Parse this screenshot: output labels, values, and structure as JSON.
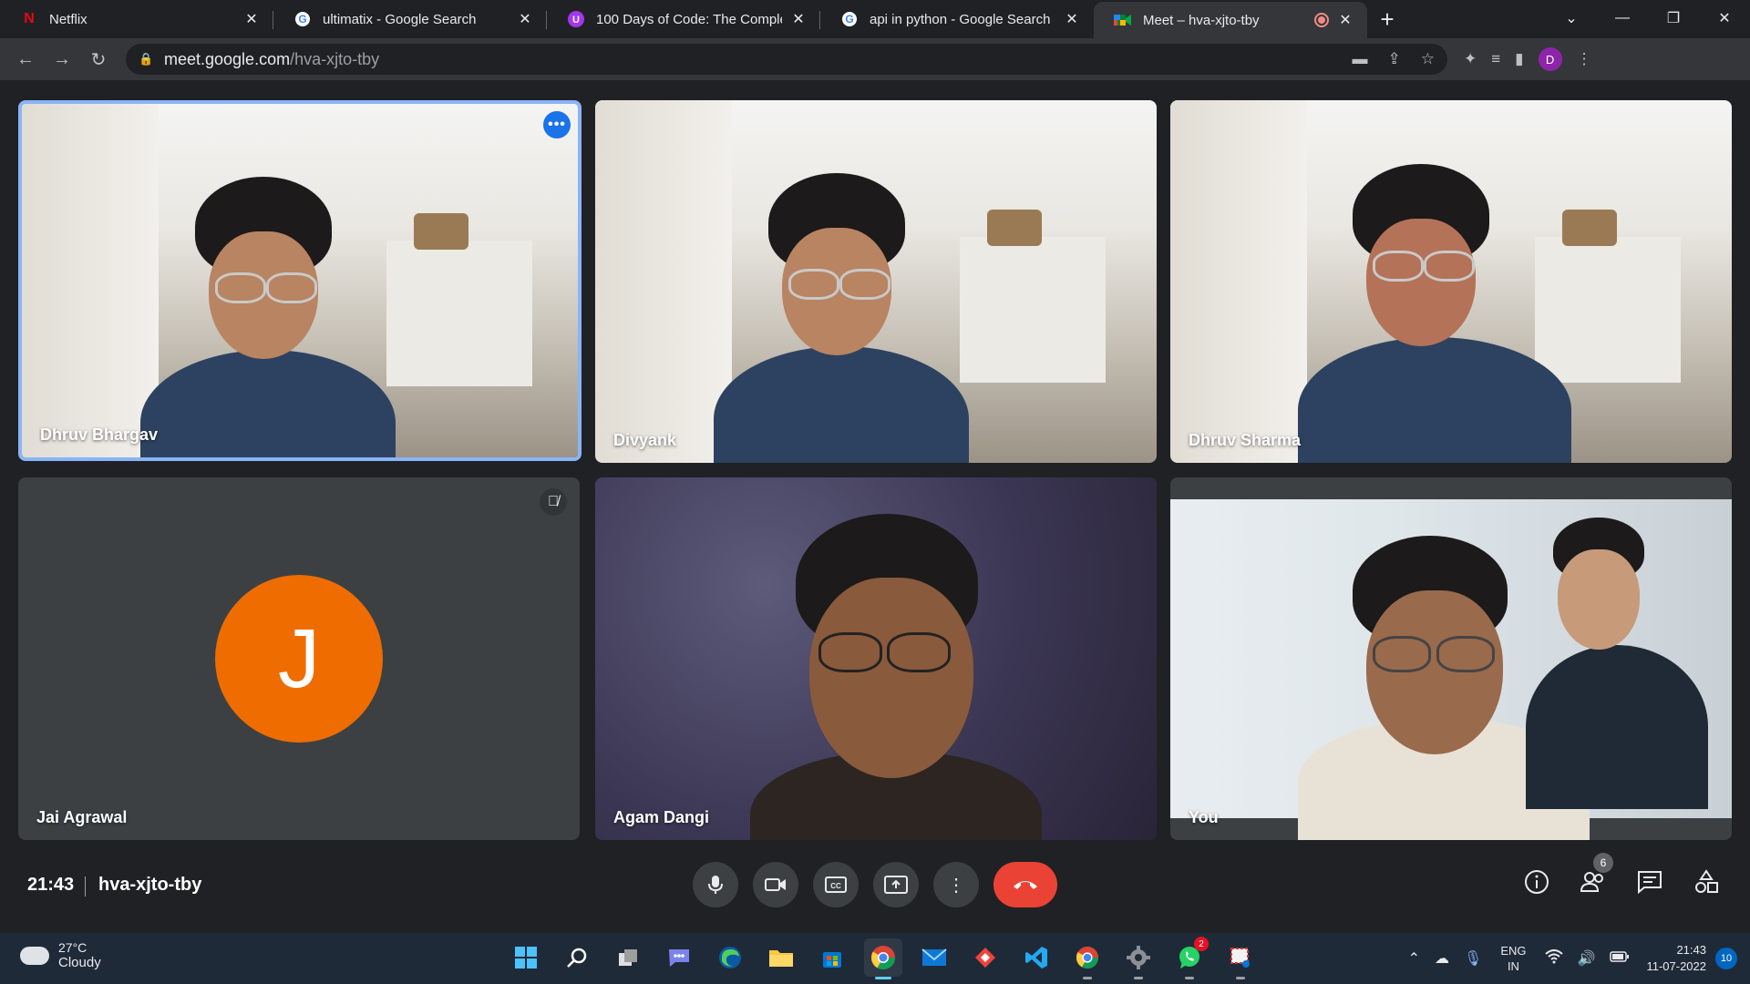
{
  "browser": {
    "tabs": [
      {
        "title": "Netflix",
        "icon": "netflix-icon"
      },
      {
        "title": "ultimatix - Google Search",
        "icon": "google-icon"
      },
      {
        "title": "100 Days of Code: The Complete",
        "icon": "udemy-icon"
      },
      {
        "title": "api in python - Google Search",
        "icon": "google-icon"
      },
      {
        "title": "Meet – hva-xjto-tby",
        "icon": "google-meet-icon",
        "active": true,
        "recording": true
      }
    ],
    "address": {
      "host": "meet.google.com",
      "path": "/hva-xjto-tby"
    },
    "profile_initial": "D"
  },
  "meet": {
    "participants": [
      {
        "name": "Dhruv Bhargav",
        "speaking": true
      },
      {
        "name": "Divyank"
      },
      {
        "name": "Dhruv Sharma"
      },
      {
        "name": "Jai Agrawal",
        "avatar_initial": "J",
        "muted": true,
        "avatar_color": "#ef6c00"
      },
      {
        "name": "Agam Dangi"
      },
      {
        "name": "You"
      }
    ],
    "time": "21:43",
    "code": "hva-xjto-tby",
    "people_count": "6",
    "colors": {
      "end_call": "#ea4335",
      "speaking_border": "#8ab4f8"
    }
  },
  "taskbar": {
    "weather": {
      "temp": "27°C",
      "condition": "Cloudy"
    },
    "whatsapp_badge": "2",
    "language": {
      "line1": "ENG",
      "line2": "IN"
    },
    "clock": {
      "time": "21:43",
      "date": "11-07-2022"
    },
    "notifications": "10"
  }
}
